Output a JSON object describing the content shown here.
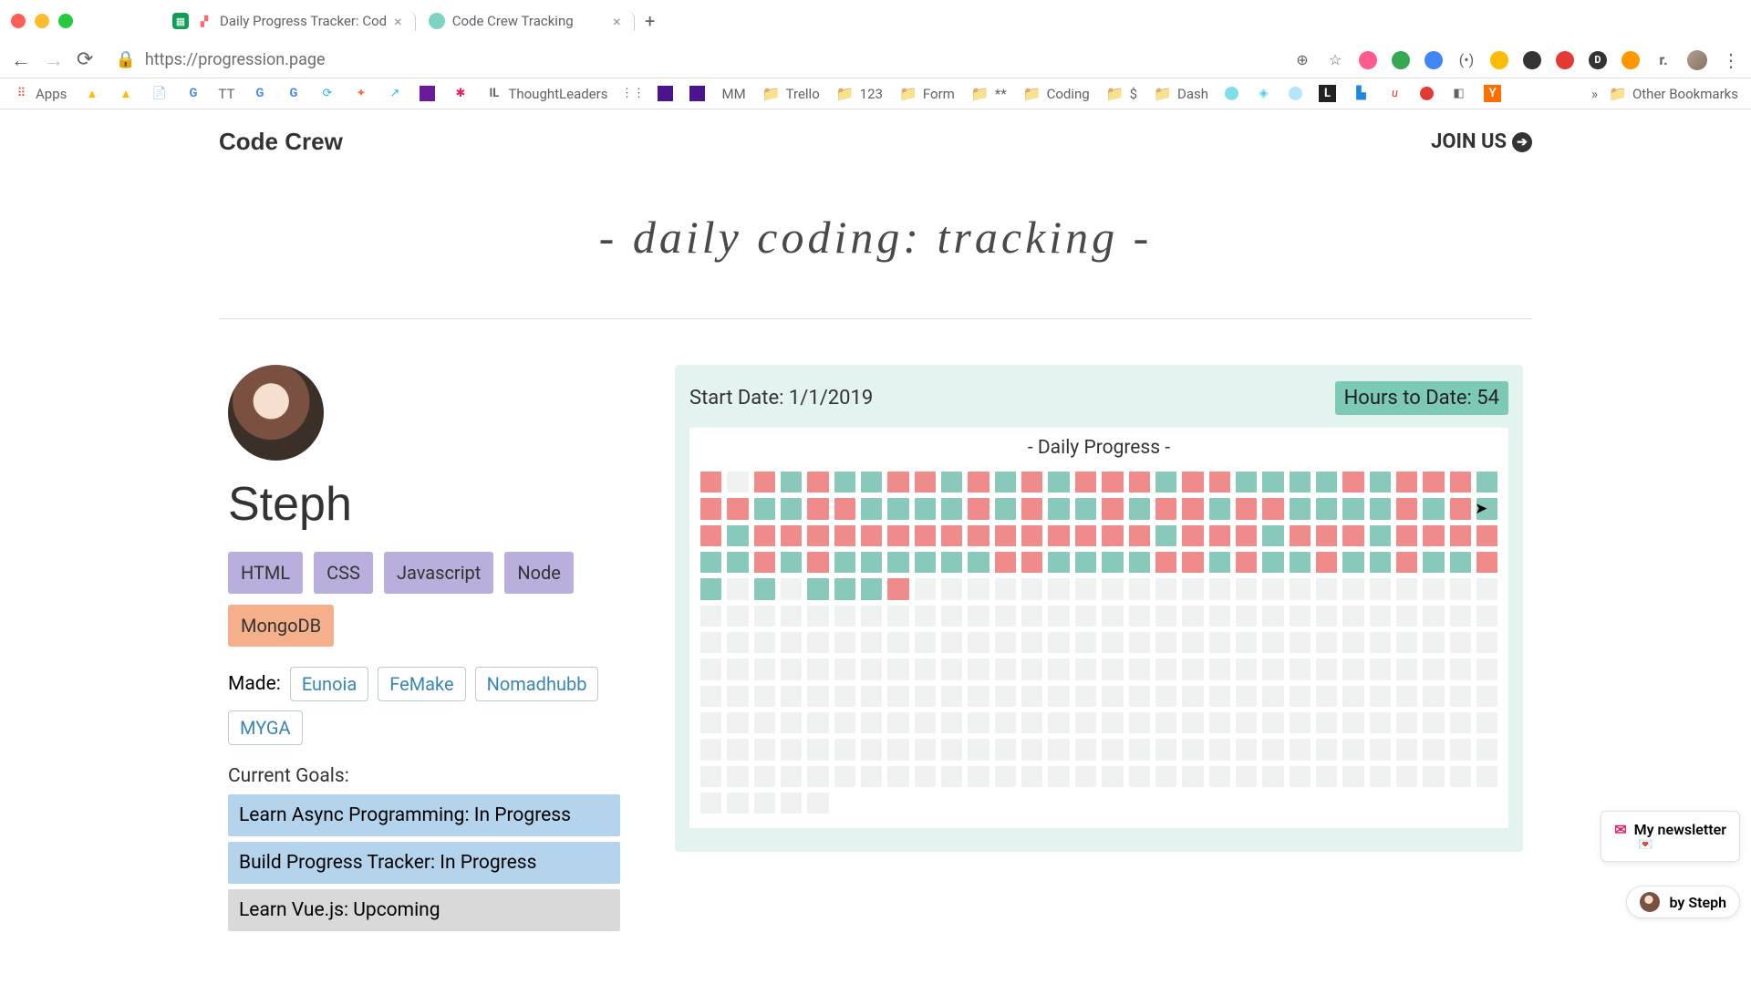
{
  "browser": {
    "tabs": [
      {
        "title": "Daily Progress Tracker: Cod"
      },
      {
        "title": "Code Crew Tracking"
      }
    ],
    "url": "https://progression.page",
    "bookmarks": [
      "Apps",
      "",
      "",
      "",
      "",
      "TT",
      "",
      "",
      "",
      "",
      "",
      "",
      "",
      "ThoughtLeaders",
      "",
      "",
      "",
      "MM",
      "Trello",
      "123",
      "Form",
      "**",
      "Coding",
      "$",
      "Dash",
      "",
      "",
      "",
      "",
      "",
      "",
      "",
      "",
      ""
    ],
    "other_bookmarks": "Other Bookmarks"
  },
  "nav": {
    "brand": "Code Crew",
    "join": "JOIN US"
  },
  "hero": {
    "title": "- daily coding: tracking -"
  },
  "profile": {
    "name": "Steph",
    "skills_p": [
      "HTML",
      "CSS",
      "Javascript",
      "Node"
    ],
    "skills_o": [
      "MongoDB"
    ],
    "made_label": "Made:",
    "made": [
      "Eunoia",
      "FeMake",
      "Nomadhubb",
      "MYGA"
    ],
    "goals_label": "Current Goals:",
    "goals": [
      {
        "text": "Learn Async Programming: In Progress",
        "cls": "blue"
      },
      {
        "text": "Build Progress Tracker: In Progress",
        "cls": "blue"
      },
      {
        "text": "Learn Vue.js: Upcoming",
        "cls": "gray"
      }
    ]
  },
  "panel": {
    "start": "Start Date: 1/1/2019",
    "hours": "Hours to Date: 54",
    "dp_title": "- Daily Progress -",
    "grid": [
      1,
      0,
      1,
      2,
      1,
      2,
      2,
      1,
      1,
      2,
      1,
      2,
      1,
      2,
      1,
      1,
      1,
      2,
      1,
      1,
      2,
      2,
      2,
      2,
      1,
      2,
      1,
      1,
      1,
      2,
      1,
      1,
      2,
      2,
      1,
      1,
      2,
      2,
      2,
      2,
      1,
      2,
      1,
      2,
      2,
      1,
      2,
      1,
      1,
      2,
      1,
      1,
      2,
      2,
      2,
      2,
      1,
      2,
      1,
      2,
      1,
      2,
      1,
      1,
      1,
      1,
      1,
      1,
      1,
      1,
      1,
      1,
      1,
      1,
      1,
      1,
      1,
      2,
      1,
      1,
      1,
      2,
      1,
      1,
      1,
      2,
      1,
      1,
      1,
      1,
      2,
      2,
      1,
      2,
      1,
      2,
      2,
      2,
      2,
      2,
      2,
      1,
      1,
      2,
      2,
      2,
      2,
      1,
      1,
      2,
      1,
      2,
      2,
      1,
      2,
      2,
      1,
      2,
      2,
      1,
      2,
      0,
      2,
      0,
      2,
      2,
      2,
      1,
      0,
      0,
      0,
      0,
      0,
      0,
      0,
      0,
      0,
      0,
      0,
      0,
      0,
      0,
      0,
      0,
      0,
      0,
      0,
      0,
      0,
      0,
      0,
      0,
      0,
      0,
      0,
      0,
      0,
      0,
      0,
      0,
      0,
      0,
      0,
      0,
      0,
      0,
      0,
      0,
      0,
      0,
      0,
      0,
      0,
      0,
      0,
      0,
      0,
      0,
      0,
      0,
      0,
      0,
      0,
      0,
      0,
      0,
      0,
      0,
      0,
      0,
      0,
      0,
      0,
      0,
      0,
      0,
      0,
      0,
      0,
      0,
      0,
      0,
      0,
      0,
      0,
      0,
      0,
      0,
      0,
      0,
      0,
      0,
      0,
      0,
      0,
      0,
      0,
      0,
      0,
      0,
      0,
      0,
      0,
      0,
      0,
      0,
      0,
      0,
      0,
      0,
      0,
      0,
      0,
      0,
      0,
      0,
      0,
      0,
      0,
      0,
      0,
      0,
      0,
      0,
      0,
      0,
      0,
      0,
      0,
      0,
      0,
      0,
      0,
      0,
      0,
      0,
      0,
      0,
      0,
      0,
      0,
      0,
      0,
      0,
      0,
      0,
      0,
      0,
      0,
      0,
      0,
      0,
      0,
      0,
      0,
      0,
      0,
      0,
      0,
      0,
      0,
      0,
      0,
      0,
      0,
      0,
      0,
      0,
      0,
      0,
      0,
      0,
      0,
      0,
      0,
      0,
      0,
      0,
      0,
      0,
      0,
      0,
      0,
      0,
      0,
      0,
      0,
      0,
      0,
      0,
      0,
      0,
      0,
      0,
      0,
      0,
      0,
      0,
      0,
      0,
      0,
      0,
      0,
      0,
      0,
      0,
      0,
      0,
      0,
      0,
      0,
      0,
      0,
      0,
      0,
      0,
      0,
      0,
      0,
      0,
      0,
      0,
      0,
      0,
      0,
      0,
      0,
      0,
      0,
      0,
      0,
      0,
      0,
      0,
      0,
      0,
      0,
      0,
      0,
      0,
      0,
      0,
      0,
      0,
      0
    ]
  },
  "float": {
    "newsletter": "My newsletter",
    "by": "by Steph"
  }
}
